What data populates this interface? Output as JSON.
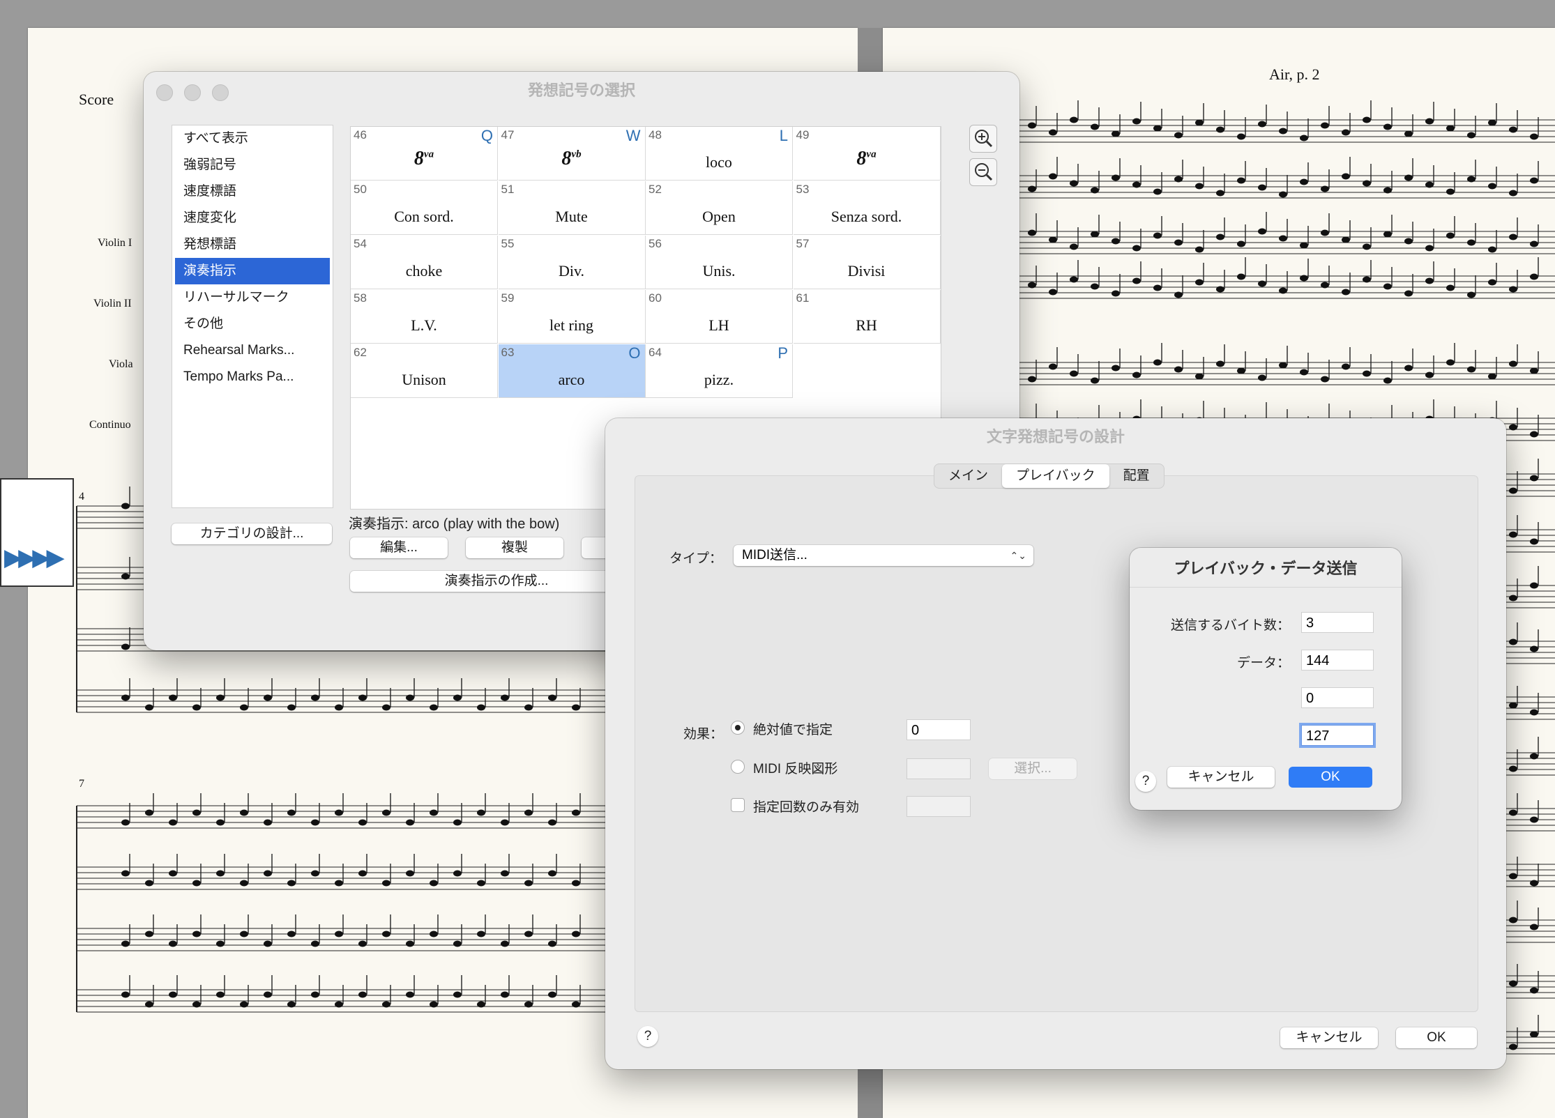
{
  "score": {
    "left_title": "Score",
    "right_title": "Air, p. 2",
    "instruments": [
      "Violin I",
      "Violin II",
      "Viola",
      "Continuo"
    ],
    "measure_numbers": [
      "4",
      "7"
    ]
  },
  "palette_window": {
    "title": "発想記号の選択",
    "categories": [
      "すべて表示",
      "強弱記号",
      "速度標語",
      "速度変化",
      "発想標語",
      "演奏指示",
      "リハーサルマーク",
      "その他",
      "Rehearsal Marks...",
      "Tempo Marks Pa..."
    ],
    "selected_category": "演奏指示",
    "cells": [
      {
        "num": "46",
        "key": "Q",
        "text": "8",
        "sup": "va",
        "ottava": true
      },
      {
        "num": "47",
        "key": "W",
        "text": "8",
        "sup": "vb",
        "ottava": true
      },
      {
        "num": "48",
        "key": "L",
        "text": "loco"
      },
      {
        "num": "49",
        "key": "",
        "text": "8",
        "sup": "va",
        "ottava": true
      },
      {
        "num": "50",
        "key": "",
        "text": "Con sord."
      },
      {
        "num": "51",
        "key": "",
        "text": "Mute"
      },
      {
        "num": "52",
        "key": "",
        "text": "Open"
      },
      {
        "num": "53",
        "key": "",
        "text": "Senza sord."
      },
      {
        "num": "54",
        "key": "",
        "text": "choke"
      },
      {
        "num": "55",
        "key": "",
        "text": "Div."
      },
      {
        "num": "56",
        "key": "",
        "text": "Unis."
      },
      {
        "num": "57",
        "key": "",
        "text": "Divisi"
      },
      {
        "num": "58",
        "key": "",
        "text": "L.V."
      },
      {
        "num": "59",
        "key": "",
        "text": "let ring"
      },
      {
        "num": "60",
        "key": "",
        "text": "LH"
      },
      {
        "num": "61",
        "key": "",
        "text": "RH"
      },
      {
        "num": "62",
        "key": "",
        "text": "Unison"
      },
      {
        "num": "63",
        "key": "O",
        "text": "arco",
        "selected": true
      },
      {
        "num": "64",
        "key": "P",
        "text": "pizz."
      }
    ],
    "description": "演奏指示: arco (play with the bow)",
    "category_design_button": "カテゴリの設計...",
    "edit_button": "編集...",
    "duplicate_button": "複製",
    "create_button": "演奏指示の作成..."
  },
  "design_window": {
    "title": "文字発想記号の設計",
    "tabs": [
      "メイン",
      "プレイバック",
      "配置"
    ],
    "active_tab": "プレイバック",
    "type_label": "タイプ：",
    "type_value": "MIDI送信...",
    "effect_label": "効果：",
    "radio_absolute": "絶対値で指定",
    "absolute_value": "0",
    "radio_midi_shape": "MIDI 反映図形",
    "select_button": "選択...",
    "checkbox_label": "指定回数のみ有効",
    "help": "?",
    "cancel": "キャンセル",
    "ok": "OK"
  },
  "playback_dialog": {
    "title": "プレイバック・データ送信",
    "bytes_label": "送信するバイト数：",
    "bytes_value": "3",
    "data_label": "データ：",
    "data_values": [
      "144",
      "0",
      "127"
    ],
    "help": "?",
    "cancel": "キャンセル",
    "ok": "OK"
  }
}
